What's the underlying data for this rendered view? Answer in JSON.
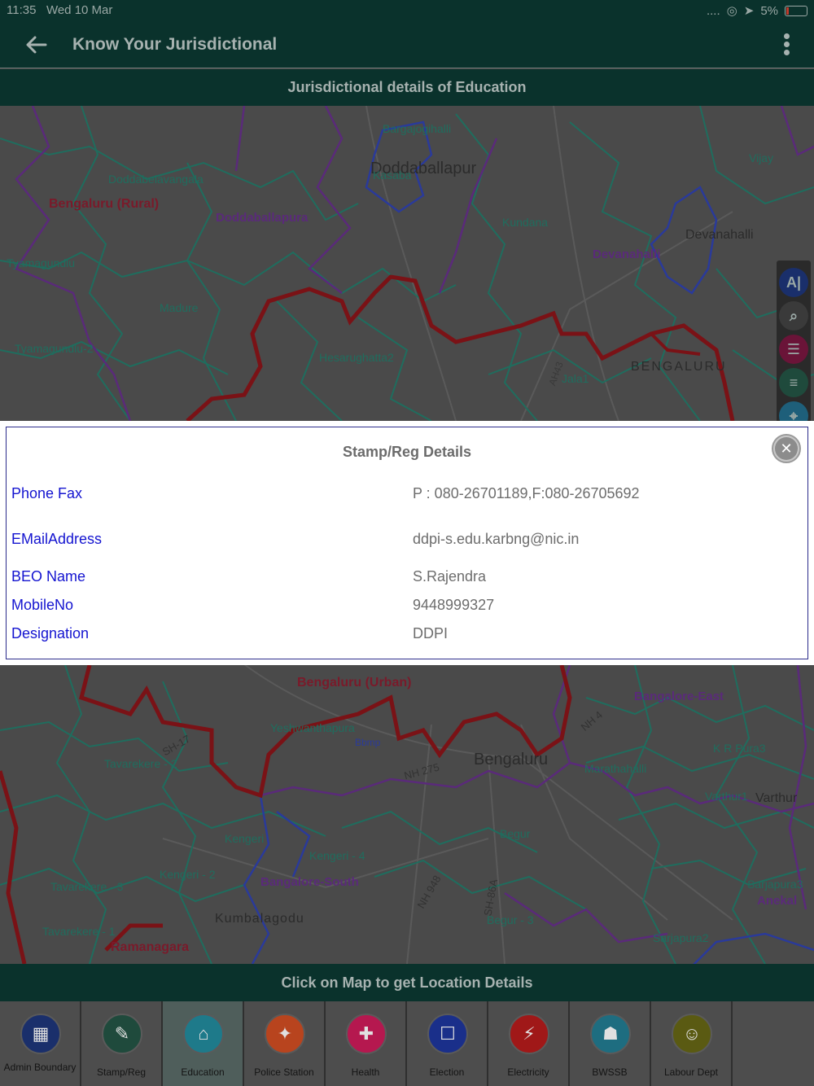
{
  "status": {
    "time": "11:35",
    "date": "Wed 10 Mar",
    "battery": "5%"
  },
  "app_bar": {
    "title": "Know Your Jurisdictional"
  },
  "sub_header": {
    "title": "Jurisdictional details of Education"
  },
  "map": {
    "labels": {
      "bengaluru_rural": "Bengaluru (Rural)",
      "doddaballapura": "Doddaballapura",
      "doddaballapur": "Doddaballapur",
      "bargajogihalli": "Bargajogihalli",
      "kasaba": "Kasaba",
      "doddabelavangala": "Doddabelavangala",
      "tyamagundlu": "Tyamagundlu",
      "tyamagundlu2": "Tyamagundlu-2",
      "madure": "Madure",
      "hesarughatta2": "Hesarughatta2",
      "kundana": "Kundana",
      "devanahalli": "Devanahalli",
      "devanahalli_town": "Devanahalli",
      "vijay": "Vijay",
      "jala1": "Jala1",
      "bengaluru_road": "BENGALURU",
      "bengaluru_urban": "Bengaluru (Urban)",
      "bangalore_east": "Bangalore-East",
      "bengaluru_city": "Bengaluru",
      "tavarekere2": "Tavarekere - 2",
      "tavarekere3": "Tavarekere - 3",
      "tavarekere1": "Tavarekere - 1",
      "yeshwanthapura": "Yeshwanthapura",
      "bbmp": "Bbmp",
      "marathahalli": "Marathahalli",
      "kr_pura3": "K R Pura3",
      "varthur1": "Varthur1",
      "varthur": "Varthur",
      "kengeri": "Kengeri",
      "kengeri4": "Kengeri - 4",
      "kengeri2": "Kengeri - 2",
      "bangalore_south": "Bangalore-South",
      "begur": "Begur",
      "kumbalagodu": "Kumbalagodu",
      "ramanagara": "Ramanagara",
      "anekal": "Anekal",
      "sarjapura3": "Sarjapura3",
      "sarjapura2": "Sarjapura2",
      "begur3": "Begur - 3",
      "nh275": "NH 275",
      "nh948": "NH 948",
      "sh86a": "SH-86A",
      "nh4": "NH 4",
      "sh17": "SH-17",
      "ah43": "AH43"
    }
  },
  "details": {
    "title": "Stamp/Reg Details",
    "rows": [
      {
        "label": "Phone Fax",
        "value": "P : 080-26701189,F:080-26705692"
      },
      {
        "label": "EMailAddress",
        "value": "ddpi-s.edu.karbng@nic.in"
      },
      {
        "label": "BEO Name",
        "value": "S.Rajendra"
      },
      {
        "label": "MobileNo",
        "value": "9448999327"
      },
      {
        "label": "Designation",
        "value": "DDPI"
      }
    ]
  },
  "footer": {
    "hint": "Click on Map to get Location Details"
  },
  "nav": [
    {
      "label": "Admin Boundary",
      "color": "#1a2f6b",
      "icon": "building-icon"
    },
    {
      "label": "Stamp/Reg",
      "color": "#1f4a3c",
      "icon": "stamp-icon"
    },
    {
      "label": "Education",
      "color": "#1e7a8a",
      "icon": "graduation-cap-icon"
    },
    {
      "label": "Police Station",
      "color": "#b8441e",
      "icon": "police-badge-icon"
    },
    {
      "label": "Health",
      "color": "#b5184f",
      "icon": "medical-cross-icon"
    },
    {
      "label": "Election",
      "color": "#1a2f8a",
      "icon": "ballot-box-icon"
    },
    {
      "label": "Electricity",
      "color": "#a01818",
      "icon": "lightning-icon"
    },
    {
      "label": "BWSSB",
      "color": "#1e6d80",
      "icon": "water-tap-icon"
    },
    {
      "label": "Labour Dept",
      "color": "#5a5a12",
      "icon": "worker-icon"
    }
  ]
}
